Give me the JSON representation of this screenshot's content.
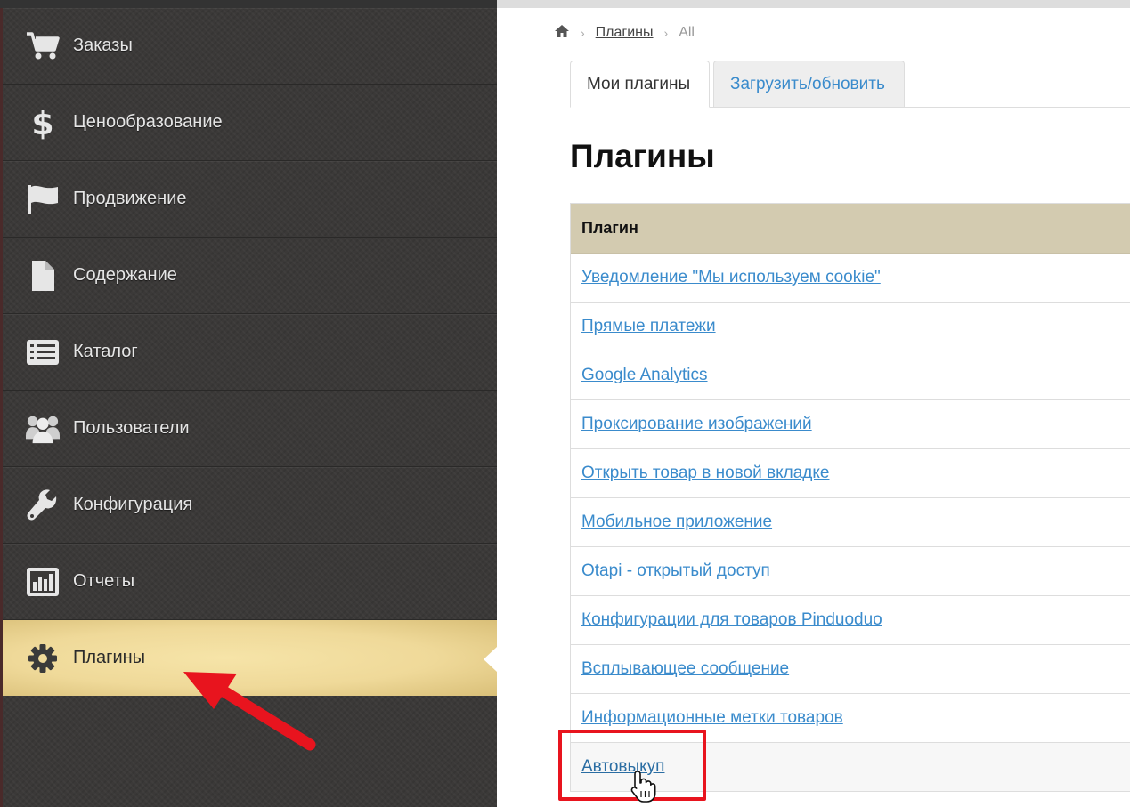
{
  "sidebar": {
    "items": [
      {
        "label": "Заказы",
        "icon": "shopping-cart-icon"
      },
      {
        "label": "Ценообразование",
        "icon": "dollar-icon"
      },
      {
        "label": "Продвижение",
        "icon": "flag-icon"
      },
      {
        "label": "Содержание",
        "icon": "file-icon"
      },
      {
        "label": "Каталог",
        "icon": "list-icon"
      },
      {
        "label": "Пользователи",
        "icon": "users-icon"
      },
      {
        "label": "Конфигурация",
        "icon": "wrench-icon"
      },
      {
        "label": "Отчеты",
        "icon": "bar-chart-icon"
      },
      {
        "label": "Плагины",
        "icon": "gear-icon",
        "active": true
      }
    ]
  },
  "breadcrumb": {
    "home_icon": "home-icon",
    "link": "Плагины",
    "current": "All"
  },
  "tabs": [
    {
      "label": "Мои плагины",
      "active": true
    },
    {
      "label": "Загрузить/обновить",
      "active": false
    }
  ],
  "page_title": "Плагины",
  "table": {
    "header": "Плагин",
    "rows": [
      "Уведомление \"Мы используем cookie\"",
      "Прямые платежи",
      "Google Analytics",
      "Проксирование изображений",
      "Открыть товар в новой вкладке",
      "Мобильное приложение",
      "Otapi - открытый доступ",
      "Конфигурации для товаров Pinduoduo",
      "Всплывающее сообщение",
      "Информационные метки товаров",
      "Автовыкуп"
    ]
  },
  "colors": {
    "accent": "#3a8bcc",
    "sidebar_bg": "#3b3938",
    "active_item": "#f1dc9c",
    "table_header": "#d3cbb0",
    "annotation": "#e8141e"
  }
}
